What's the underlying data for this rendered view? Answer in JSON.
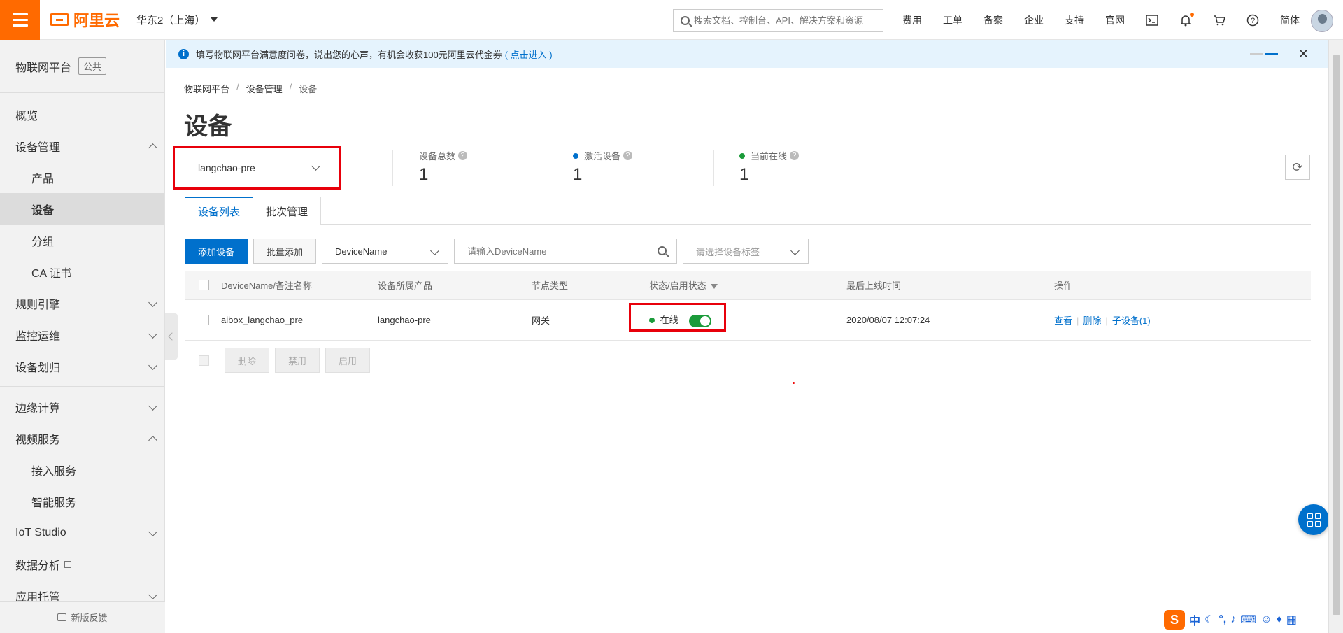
{
  "topbar": {
    "logo_text": "阿里云",
    "region": "华东2（上海）",
    "search_placeholder": "搜索文档、控制台、API、解决方案和资源",
    "nav": [
      "费用",
      "工单",
      "备案",
      "企业",
      "支持",
      "官网"
    ],
    "lang": "简体"
  },
  "sidebar": {
    "title": "物联网平台",
    "badge": "公共",
    "items": [
      {
        "label": "概览"
      },
      {
        "label": "设备管理"
      },
      {
        "label": "产品"
      },
      {
        "label": "设备"
      },
      {
        "label": "分组"
      },
      {
        "label": "CA 证书"
      },
      {
        "label": "规则引擎"
      },
      {
        "label": "监控运维"
      },
      {
        "label": "设备划归"
      },
      {
        "label": "边缘计算"
      },
      {
        "label": "视频服务"
      },
      {
        "label": "接入服务"
      },
      {
        "label": "智能服务"
      },
      {
        "label": "IoT Studio"
      },
      {
        "label": "数据分析"
      },
      {
        "label": "应用托管"
      }
    ],
    "feedback": "新版反馈"
  },
  "notice": {
    "text": "填写物联网平台满意度问卷，说出您的心声，有机会收获100元阿里云代金券",
    "link": "( 点击进入 )"
  },
  "breadcrumb": [
    "物联网平台",
    "设备管理",
    "设备"
  ],
  "page_title": "设备",
  "product_select": "langchao-pre",
  "stats": {
    "total_label": "设备总数",
    "total_value": "1",
    "active_label": "激活设备",
    "active_value": "1",
    "online_label": "当前在线",
    "online_value": "1"
  },
  "tabs": [
    "设备列表",
    "批次管理"
  ],
  "toolbar": {
    "add": "添加设备",
    "batch_add": "批量添加",
    "filter_field": "DeviceName",
    "search_placeholder": "请输入DeviceName",
    "tag_placeholder": "请选择设备标签"
  },
  "table": {
    "headers": [
      "DeviceName/备注名称",
      "设备所属产品",
      "节点类型",
      "状态/启用状态",
      "最后上线时间",
      "操作"
    ],
    "rows": [
      {
        "name": "aibox_langchao_pre",
        "product": "langchao-pre",
        "node_type": "网关",
        "status": "在线",
        "last_online": "2020/08/07 12:07:24",
        "actions": [
          "查看",
          "删除",
          "子设备(1)"
        ]
      }
    ]
  },
  "batch_actions": [
    "删除",
    "禁用",
    "启用"
  ],
  "colors": {
    "brand": "#ff6a00",
    "primary": "#0070cc",
    "online": "#1b9b3a",
    "highlight": "#e8000b"
  }
}
